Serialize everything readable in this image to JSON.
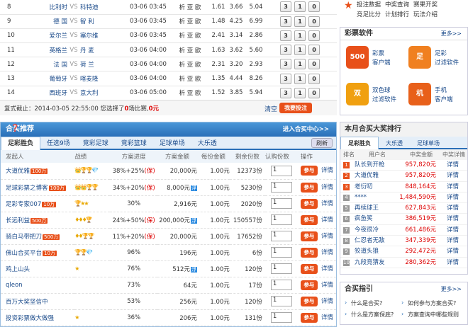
{
  "matches": [
    {
      "no": "8",
      "home": "比利时",
      "away": "科特迪",
      "time": "03-06 03:45",
      "detail": "析 亚 欧",
      "o1": "1.61",
      "o2": "3.66",
      "o3": "5.04"
    },
    {
      "no": "9",
      "home": "德 国",
      "away": "智 利",
      "time": "03-06 03:45",
      "detail": "析 亚 欧",
      "o1": "1.48",
      "o2": "4.25",
      "o3": "6.99"
    },
    {
      "no": "10",
      "home": "爱尔兰",
      "away": "塞尔维",
      "time": "03-06 03:45",
      "detail": "析 亚 欧",
      "o1": "2.41",
      "o2": "3.14",
      "o3": "2.86"
    },
    {
      "no": "11",
      "home": "英格兰",
      "away": "丹 麦",
      "time": "03-06 04:00",
      "detail": "析 亚 欧",
      "o1": "1.63",
      "o2": "3.62",
      "o3": "5.60"
    },
    {
      "no": "12",
      "home": "法 国",
      "away": "荷 兰",
      "time": "03-06 04:00",
      "detail": "析 亚 欧",
      "o1": "2.31",
      "o2": "3.20",
      "o3": "2.93"
    },
    {
      "no": "13",
      "home": "葡萄牙",
      "away": "喀麦隆",
      "time": "03-06 04:00",
      "detail": "析 亚 欧",
      "o1": "1.35",
      "o2": "4.44",
      "o3": "8.26"
    },
    {
      "no": "14",
      "home": "西班牙",
      "away": "意大利",
      "time": "03-06 05:00",
      "detail": "析 亚 欧",
      "o1": "1.52",
      "o2": "3.85",
      "o3": "5.94"
    }
  ],
  "vs": "VS",
  "picks": [
    "3",
    "1",
    "0"
  ],
  "deadline": {
    "prefix": "复式截止：2014-03-05 22:55:00 您选择了",
    "count": "0",
    "mid": "场比赛,",
    "amount": "0",
    "suffix": "元",
    "clear": "清空",
    "submit": "我要投注"
  },
  "hemai": {
    "title": "合买推荐",
    "enter": "进入合买中心>>",
    "tabs": [
      "足彩胜负",
      "任选9场",
      "竞彩足球",
      "竞彩篮球",
      "足球单场",
      "大乐透"
    ],
    "refresh": "刷新",
    "headers": [
      "发起人",
      "战绩",
      "方案进度",
      "方案金额",
      "每份金额",
      "剩余份数",
      "认购份数",
      "操作"
    ],
    "rows": [
      {
        "name": "大道优雅",
        "badge": "100万",
        "rank": "👑🏆🏆💎",
        "prog": "38%+25%",
        "bao": "(保)",
        "amount": "20,000元",
        "fu": "",
        "each": "1.00元",
        "left": "12373份",
        "v": "1",
        "buy": "参与",
        "det": "详情"
      },
      {
        "name": "足球彩票之博客",
        "badge": "100万",
        "rank": "👑👑🏆🏆",
        "prog": "34%+20%",
        "bao": "(保)",
        "amount": "8,000元",
        "fu": "浮",
        "each": "1.00元",
        "left": "5230份",
        "v": "1",
        "buy": "参与",
        "det": "详情"
      },
      {
        "name": "足彩专家007",
        "badge": "10万",
        "rank": "🏆★★",
        "prog": "30%",
        "bao": "",
        "amount": "2,916元",
        "fu": "",
        "each": "1.00元",
        "left": "2020份",
        "v": "1",
        "buy": "参与",
        "det": "详情"
      },
      {
        "name": "长远利益",
        "badge": "500万",
        "rank": "♦♦♦🏆",
        "prog": "24%+50%",
        "bao": "(保)",
        "amount": "200,000元",
        "fu": "浮",
        "each": "1.00元",
        "left": "150557份",
        "v": "1",
        "buy": "参与",
        "det": "详情"
      },
      {
        "name": "骑白马带把刀",
        "badge": "500万",
        "rank": "♦♦🏆🏆",
        "prog": "11%+20%",
        "bao": "(保)",
        "amount": "20,000元",
        "fu": "",
        "each": "1.00元",
        "left": "17652份",
        "v": "1",
        "buy": "参与",
        "det": "详情"
      },
      {
        "name": "佛山合买平台",
        "badge": "10万",
        "rank": "🏆🏆💎",
        "prog": "96%",
        "bao": "",
        "amount": "196元",
        "fu": "",
        "each": "1.00元",
        "left": "6份",
        "v": "1",
        "buy": "参与",
        "det": "详情"
      },
      {
        "name": "鸡上山头",
        "badge": "",
        "rank": "★",
        "prog": "76%",
        "bao": "",
        "amount": "512元",
        "fu": "浮",
        "each": "1.00元",
        "left": "120份",
        "v": "1",
        "buy": "参与",
        "det": "详情"
      },
      {
        "name": "qleon",
        "badge": "",
        "rank": "",
        "prog": "73%",
        "bao": "",
        "amount": "64元",
        "fu": "",
        "each": "1.00元",
        "left": "17份",
        "v": "1",
        "buy": "参与",
        "det": "详情"
      },
      {
        "name": "百万大奖坚信中",
        "badge": "",
        "rank": "",
        "prog": "53%",
        "bao": "",
        "amount": "256元",
        "fu": "",
        "each": "1.00元",
        "left": "120份",
        "v": "1",
        "buy": "参与",
        "det": "详情"
      },
      {
        "name": "投资彩票做大做强",
        "badge": "",
        "rank": "★",
        "prog": "36%",
        "bao": "",
        "amount": "206元",
        "fu": "",
        "each": "1.00元",
        "left": "131份",
        "v": "1",
        "buy": "参与",
        "det": "详情"
      }
    ]
  },
  "topright": {
    "items": [
      [
        "投注数据",
        "中奖查询",
        "赛果开奖"
      ],
      [
        "竞足比分",
        "计划排行",
        "玩法介绍"
      ]
    ]
  },
  "software": {
    "title": "彩票软件",
    "more": "更多>>",
    "apps": [
      {
        "icon": "500",
        "l1": "彩票",
        "l2": "客户端",
        "c": "#e8501a"
      },
      {
        "icon": "足",
        "l1": "足彩",
        "l2": "过滤软件",
        "c": "#f08020"
      },
      {
        "icon": "双",
        "l1": "双色球",
        "l2": "过滤软件",
        "c": "#f0a010"
      },
      {
        "icon": "机",
        "l1": "手机",
        "l2": "客户端",
        "c": "#e8601a"
      }
    ]
  },
  "ranking": {
    "title": "本月合买大奖排行",
    "tabs": [
      "足彩胜负",
      "大乐透",
      "足球单场"
    ],
    "headers": [
      "排名",
      "用户名",
      "中奖金额",
      "中奖详情"
    ],
    "rows": [
      {
        "r": "1",
        "u": "队长到开枪",
        "m": "957,820元",
        "d": "详情"
      },
      {
        "r": "2",
        "u": "大道优雅",
        "m": "957,820元",
        "d": "详情"
      },
      {
        "r": "3",
        "u": "老衍叨",
        "m": "848,164元",
        "d": "详情"
      },
      {
        "r": "4",
        "u": "****",
        "m": "1,484,590元",
        "d": "详情"
      },
      {
        "r": "5",
        "u": "再续球王",
        "m": "627,843元",
        "d": "详情"
      },
      {
        "r": "6",
        "u": "疯鱼笑",
        "m": "386,519元",
        "d": "详情"
      },
      {
        "r": "7",
        "u": "今夜很冷",
        "m": "661,486元",
        "d": "详情"
      },
      {
        "r": "8",
        "u": "仁忍者无敌",
        "m": "347,339元",
        "d": "详情"
      },
      {
        "r": "9",
        "u": "狡道头狼",
        "m": "292,472元",
        "d": "详情"
      },
      {
        "r": "10",
        "u": "九段竞猜友",
        "m": "280,362元",
        "d": "详情"
      }
    ]
  },
  "guide": {
    "title": "合买指引",
    "more": "更多>>",
    "items": [
      "什么是合买?",
      "如何参与方案合买?",
      "什么是方案保底?",
      "方案查询中哪些规则"
    ]
  }
}
